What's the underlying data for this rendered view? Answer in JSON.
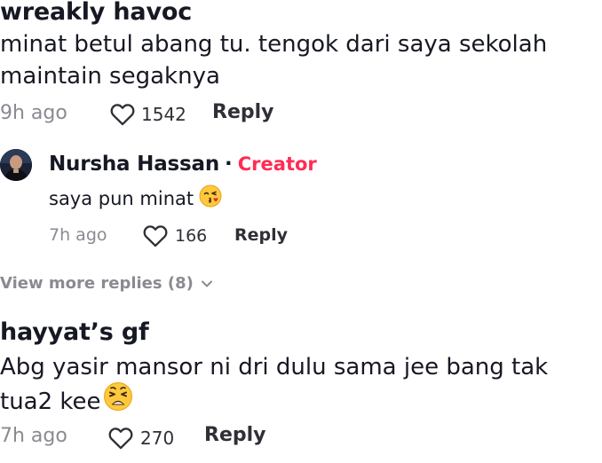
{
  "comments": [
    {
      "username": "wreakly havoc",
      "text_line1": "minat betul abang tu. tengok dari saya sekolah",
      "text_line2": "maintain segaknya",
      "time": "9h ago",
      "likes": "1542",
      "reply_label": "Reply"
    },
    {
      "username": "hayyat’s gf",
      "text_line1": "Abg yasir mansor ni dri dulu sama jee bang tak",
      "text_line2": "tua2 kee",
      "text_line2_emoji": "weary-face-emoji",
      "time": "7h ago",
      "likes": "270",
      "reply_label": "Reply"
    }
  ],
  "reply": {
    "username": "Nursha Hassan",
    "separator": "·",
    "badge": "Creator",
    "text": "saya pun minat",
    "text_emoji": "kissing-face-emoji",
    "time": "7h ago",
    "likes": "166",
    "reply_label": "Reply"
  },
  "view_more": {
    "label": "View more replies (8)",
    "icon": "chevron-down-icon"
  },
  "colors": {
    "creator": "#fe2c55",
    "meta": "#8a8b91",
    "text": "#161823"
  }
}
